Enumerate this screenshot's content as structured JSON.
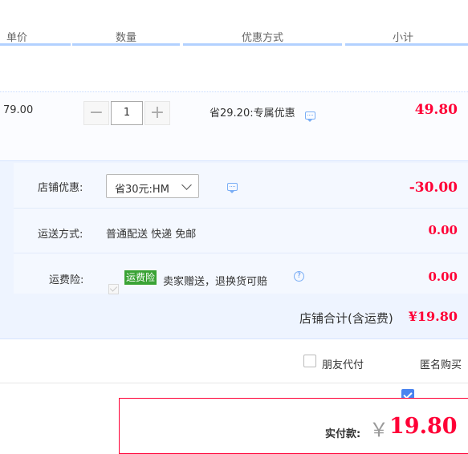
{
  "header": {
    "col_price": "单价",
    "col_qty": "数量",
    "col_promo": "优惠方式",
    "col_subtotal": "小计"
  },
  "item": {
    "unit_price": "79.00",
    "quantity": "1",
    "minus_label": "−",
    "plus_label": "+",
    "promo_text": "省29.20:专属优惠",
    "subtotal": "49.80"
  },
  "shop": {
    "discount_label": "店铺优惠:",
    "discount_selected": "省30元:HM",
    "discount_amount": "-30.00",
    "shipping_label": "运送方式:",
    "shipping_value": "普通配送 快递 免邮",
    "shipping_amount": "0.00",
    "insurance_label": "运费险:",
    "insurance_badge": "运费险",
    "insurance_text": "卖家赠送，退换货可赔",
    "insurance_amount": "0.00",
    "help_symbol": "?"
  },
  "total": {
    "label": "店铺合计(含运费)",
    "amount": "¥19.80"
  },
  "options": {
    "friend_pay": "朋友代付",
    "anonymous": "匿名购买"
  },
  "payment": {
    "label": "实付款:",
    "currency": "￥",
    "amount": "19.80"
  },
  "colors": {
    "accent_red": "#ff0036",
    "header_line": "#b2d1ff",
    "shop_bg": "#eef4ff",
    "badge_green": "#3aa335",
    "checkbox_blue": "#4a84f0"
  },
  "icons": [
    "chat-icon",
    "help-icon",
    "chevron-down-icon",
    "check-icon"
  ]
}
